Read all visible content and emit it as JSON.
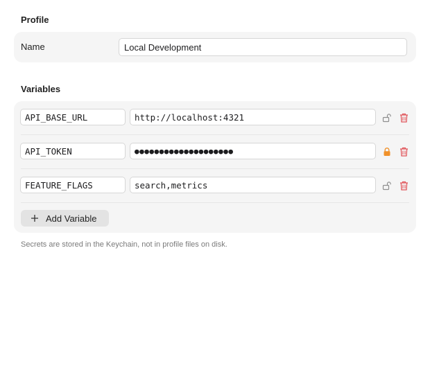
{
  "profile": {
    "section_title": "Profile",
    "name_label": "Name",
    "name_value": "Local Development"
  },
  "variables": {
    "section_title": "Variables",
    "items": [
      {
        "key": "API_BASE_URL",
        "value": "http://localhost:4321",
        "secret": false,
        "lock_icon": "unlocked-icon",
        "delete_icon": "trash-icon"
      },
      {
        "key": "API_TOKEN",
        "value": "●●●●●●●●●●●●●●●●●●●●",
        "secret": true,
        "lock_icon": "locked-icon",
        "delete_icon": "trash-icon"
      },
      {
        "key": "FEATURE_FLAGS",
        "value": "search,metrics",
        "secret": false,
        "lock_icon": "unlocked-icon",
        "delete_icon": "trash-icon"
      }
    ],
    "add_label": "Add Variable",
    "add_icon": "plus-icon"
  },
  "footnote": "Secrets are stored in the Keychain, not in profile files on disk.",
  "colors": {
    "lock_active": "#f0912a",
    "lock_inactive": "#8e8e8e",
    "trash": "#e0555a",
    "panel": "#f5f5f5"
  }
}
